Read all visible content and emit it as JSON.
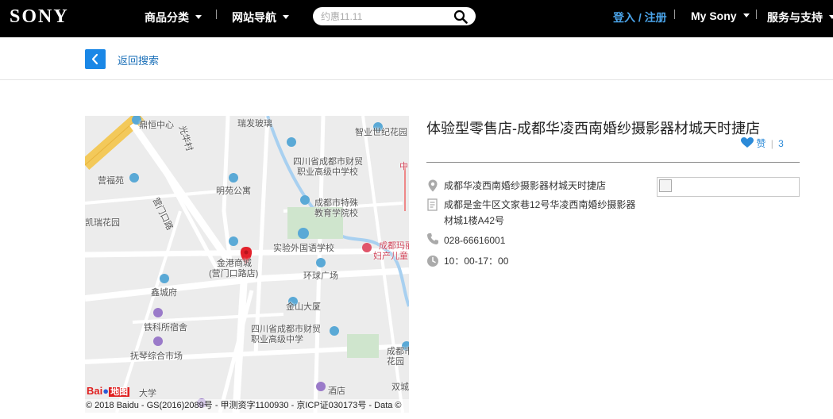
{
  "header": {
    "logo": "SONY",
    "nav_products": "商品分类",
    "nav_site": "网站导航",
    "search_placeholder": "约惠11.11",
    "login": "登入 / 注册",
    "my_sony": "My Sony",
    "service": "服务与支持"
  },
  "subbar": {
    "back_label": "返回搜索"
  },
  "map": {
    "labels": [
      "瑞发玻璃",
      "鼎恒中心",
      "智业世纪花园",
      "四川省成都市财贸",
      "职业高级中学校",
      "营福苑",
      "明苑公寓",
      "成都市特殊",
      "教育学院校",
      "凯瑞花园",
      "实验外国语学校",
      "成都玛丽",
      "妇产儿童",
      "金港商城",
      "(营门口路店)",
      "环球广场",
      "鑫城府",
      "金山大厦",
      "四川省成都市财贸",
      "职业高级中学",
      "铁科所宿舍",
      "抚琴综合市场",
      "成都市",
      "花园",
      "双城",
      "酒店",
      "大学",
      "营门口路",
      "光华村",
      "中"
    ],
    "copyright": "© 2018 Baidu - GS(2016)2089号 - 甲测资字1100930 - 京ICP证030173号 - Data ©",
    "brand": "Bai",
    "brand2": "地图"
  },
  "store": {
    "title": "体验型零售店-成都华凌西南婚纱摄影器材城天时捷店",
    "like_label": "赞",
    "like_count": "3",
    "name": "成都华凌西南婚纱摄影器材城天时捷店",
    "address_line1": "成都是金牛区文家巷12号华凌西南婚纱摄影器",
    "address_line2": "材城1楼A42号",
    "phone": "028-66616001",
    "hours": "10：00-17：00"
  },
  "colors": {
    "accent": "#1a87e6",
    "link": "#4aa3e8",
    "header_bg": "#000000"
  }
}
